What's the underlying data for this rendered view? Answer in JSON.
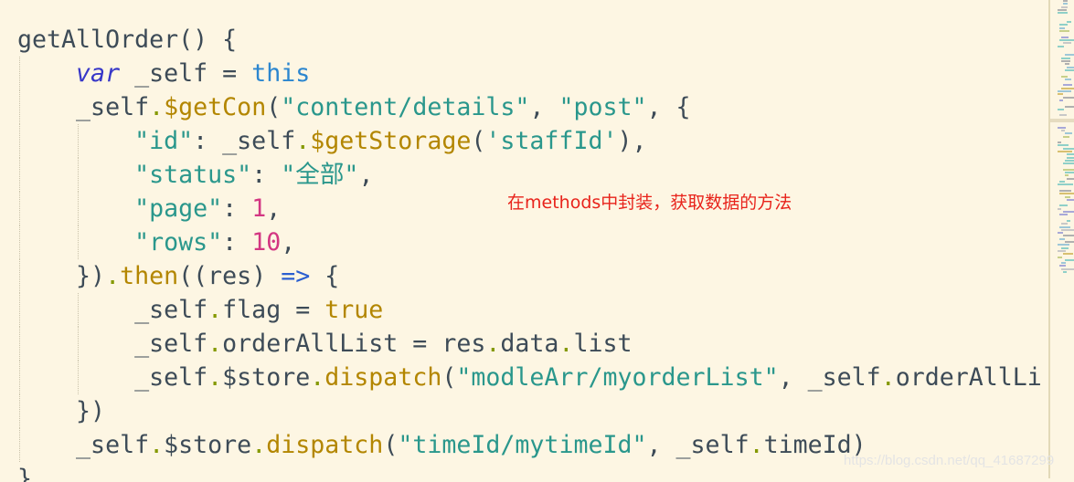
{
  "code_lines": [
    [
      {
        "t": "    ",
        "c": ""
      },
      {
        "t": "",
        "c": ""
      }
    ],
    [
      {
        "t": "getAllOrder() {",
        "c": ""
      }
    ],
    [
      {
        "t": "    ",
        "c": ""
      },
      {
        "t": "var",
        "c": "kw"
      },
      {
        "t": " _self = ",
        "c": ""
      },
      {
        "t": "this",
        "c": "this"
      }
    ],
    [
      {
        "t": "    _self",
        "c": ""
      },
      {
        "t": ".",
        "c": "dot"
      },
      {
        "t": "$getCon",
        "c": "fn"
      },
      {
        "t": "(",
        "c": ""
      },
      {
        "t": "\"content/details\"",
        "c": "str"
      },
      {
        "t": ", ",
        "c": ""
      },
      {
        "t": "\"post\"",
        "c": "str"
      },
      {
        "t": ", {",
        "c": ""
      }
    ],
    [
      {
        "t": "        ",
        "c": ""
      },
      {
        "t": "\"id\"",
        "c": "str"
      },
      {
        "t": ": _self",
        "c": ""
      },
      {
        "t": ".",
        "c": "dot"
      },
      {
        "t": "$getStorage",
        "c": "fn"
      },
      {
        "t": "(",
        "c": ""
      },
      {
        "t": "'staffId'",
        "c": "str"
      },
      {
        "t": "),",
        "c": ""
      }
    ],
    [
      {
        "t": "        ",
        "c": ""
      },
      {
        "t": "\"status\"",
        "c": "str"
      },
      {
        "t": ": ",
        "c": ""
      },
      {
        "t": "\"全部\"",
        "c": "str"
      },
      {
        "t": ",",
        "c": ""
      }
    ],
    [
      {
        "t": "        ",
        "c": ""
      },
      {
        "t": "\"page\"",
        "c": "str"
      },
      {
        "t": ": ",
        "c": ""
      },
      {
        "t": "1",
        "c": "num"
      },
      {
        "t": ",",
        "c": ""
      }
    ],
    [
      {
        "t": "        ",
        "c": ""
      },
      {
        "t": "\"rows\"",
        "c": "str"
      },
      {
        "t": ": ",
        "c": ""
      },
      {
        "t": "10",
        "c": "num"
      },
      {
        "t": ",",
        "c": ""
      }
    ],
    [
      {
        "t": "    })",
        "c": ""
      },
      {
        "t": ".",
        "c": "dot"
      },
      {
        "t": "then",
        "c": "fn"
      },
      {
        "t": "((res) ",
        "c": ""
      },
      {
        "t": "=>",
        "c": "arrow"
      },
      {
        "t": " {",
        "c": ""
      }
    ],
    [
      {
        "t": "        _self",
        "c": ""
      },
      {
        "t": ".",
        "c": "dot"
      },
      {
        "t": "flag = ",
        "c": ""
      },
      {
        "t": "true",
        "c": "bool"
      }
    ],
    [
      {
        "t": "        _self",
        "c": ""
      },
      {
        "t": ".",
        "c": "dot"
      },
      {
        "t": "orderAllList = res",
        "c": ""
      },
      {
        "t": ".",
        "c": "dot"
      },
      {
        "t": "data",
        "c": ""
      },
      {
        "t": ".",
        "c": "dot"
      },
      {
        "t": "list",
        "c": ""
      }
    ],
    [
      {
        "t": "        _self",
        "c": ""
      },
      {
        "t": ".",
        "c": "dot"
      },
      {
        "t": "$store",
        "c": ""
      },
      {
        "t": ".",
        "c": "dot"
      },
      {
        "t": "dispatch",
        "c": "fn"
      },
      {
        "t": "(",
        "c": ""
      },
      {
        "t": "\"modleArr/myorderList\"",
        "c": "str"
      },
      {
        "t": ", _self",
        "c": ""
      },
      {
        "t": ".",
        "c": "dot"
      },
      {
        "t": "orderAllList",
        "c": ""
      }
    ],
    [
      {
        "t": "    })",
        "c": ""
      }
    ],
    [
      {
        "t": "    _self",
        "c": ""
      },
      {
        "t": ".",
        "c": "dot"
      },
      {
        "t": "$store",
        "c": ""
      },
      {
        "t": ".",
        "c": "dot"
      },
      {
        "t": "dispatch",
        "c": "fn"
      },
      {
        "t": "(",
        "c": ""
      },
      {
        "t": "\"timeId/mytimeId\"",
        "c": "str"
      },
      {
        "t": ", _self",
        "c": ""
      },
      {
        "t": ".",
        "c": "dot"
      },
      {
        "t": "timeId)",
        "c": ""
      }
    ],
    [
      {
        "t": "},",
        "c": ""
      }
    ]
  ],
  "annotation": "在methods中封装，获取数据的方法",
  "watermark": "https://blog.csdn.net/qq_41687299",
  "colors": {
    "background": "#fdf6e3",
    "annotation": "#e8231b",
    "string": "#2a978c",
    "number": "#d33682",
    "method": "#b38600"
  }
}
